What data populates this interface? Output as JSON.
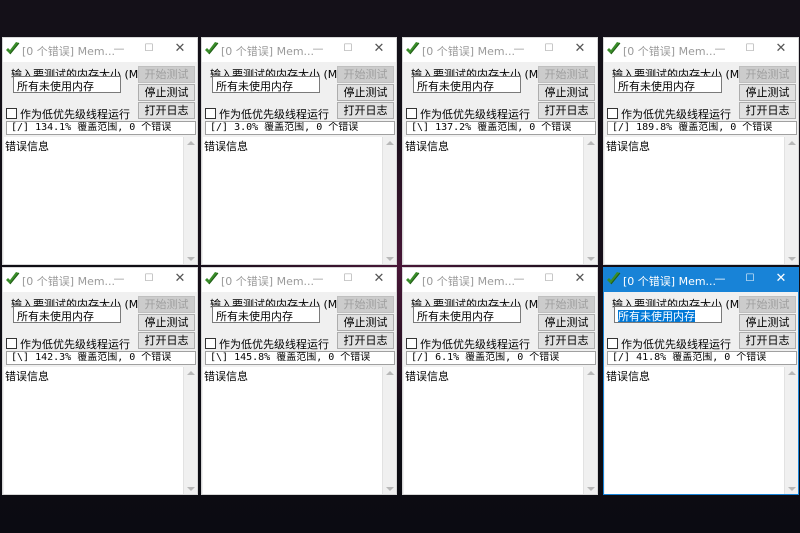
{
  "windows": [
    {
      "title": "[0 个错误] Mem...",
      "status": "[/]  134.1% 覆盖范围, 0 个错误",
      "active": false
    },
    {
      "title": "[0 个错误] Mem...",
      "status": "[/]  3.0% 覆盖范围, 0 个错误",
      "active": false
    },
    {
      "title": "[0 个错误] Mem...",
      "status": "[\\]  137.2% 覆盖范围, 0 个错误",
      "active": false
    },
    {
      "title": "[0 个错误] Mem...",
      "status": "[/]  189.8% 覆盖范围, 0 个错误",
      "active": false
    },
    {
      "title": "[0 个错误] Mem...",
      "status": "[\\]  142.3% 覆盖范围, 0 个错误",
      "active": false
    },
    {
      "title": "[0 个错误] Mem...",
      "status": "[\\]  145.8% 覆盖范围, 0 个错误",
      "active": false
    },
    {
      "title": "[0 个错误] Mem...",
      "status": "[/]  6.1% 覆盖范围, 0 个错误",
      "active": false
    },
    {
      "title": "[0 个错误] Mem...",
      "status": "[/]  41.8% 覆盖范围, 0 个错误",
      "active": true
    }
  ],
  "labels": {
    "size_prompt": "输入要测试的内存大小 (MB)",
    "size_value": "所有未使用内存",
    "start": "开始测试",
    "stop": "停止测试",
    "log": "打开日志",
    "low_priority": "作为低优先级线程运行",
    "error_info": "错误信息",
    "min": "—",
    "max": "☐",
    "close": "✕"
  },
  "icons": {
    "app": "memtest-app-icon",
    "minimize": "minimize-icon",
    "maximize": "maximize-icon",
    "close": "close-icon"
  },
  "colors": {
    "active_titlebar": "#1883d7",
    "inactive_title_text": "#9a9a9a",
    "window_bg": "#f0f0f0"
  }
}
